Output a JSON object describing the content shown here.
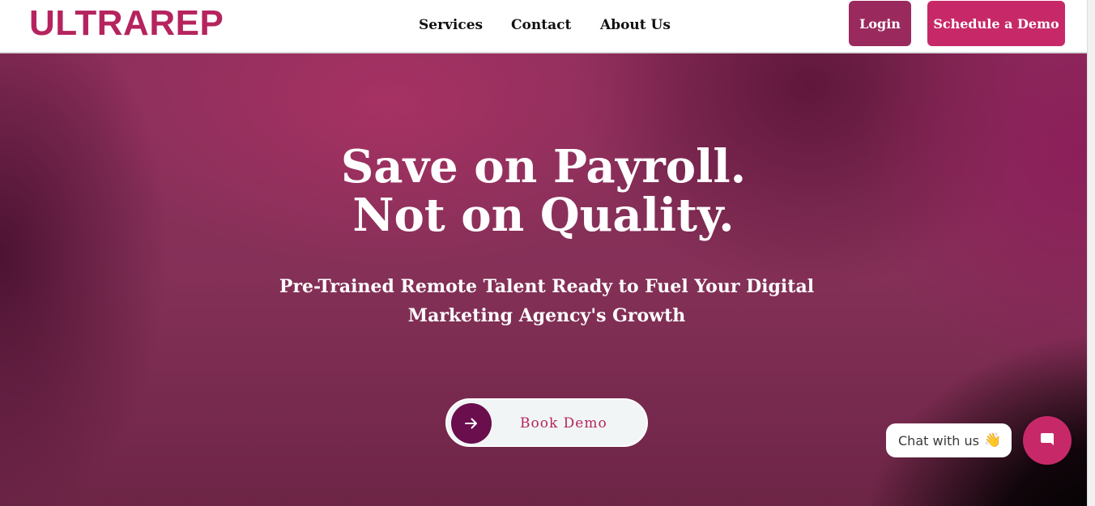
{
  "brand": {
    "logo_text": "ULTRAREP"
  },
  "nav": {
    "links": [
      "Services",
      "Contact",
      "About Us"
    ],
    "login_label": "Login",
    "schedule_label": "Schedule a Demo"
  },
  "hero": {
    "headline_line1": "Save on Payroll.",
    "headline_line2": "Not on Quality.",
    "subheadline": "Pre-Trained Remote Talent Ready to Fuel Your Digital Marketing Agency's Growth",
    "cta_label": "Book Demo"
  },
  "chat": {
    "bubble_text": "Chat with us",
    "bubble_emoji": "👋"
  },
  "icons": {
    "cta": "arrow-right-icon",
    "chat": "chat-bubble-icon"
  },
  "colors": {
    "brand_pink": "#c72968",
    "brand_plum": "#9a2a5e",
    "arrow_circle": "#6a0e4d",
    "hero_base": "#843057"
  }
}
